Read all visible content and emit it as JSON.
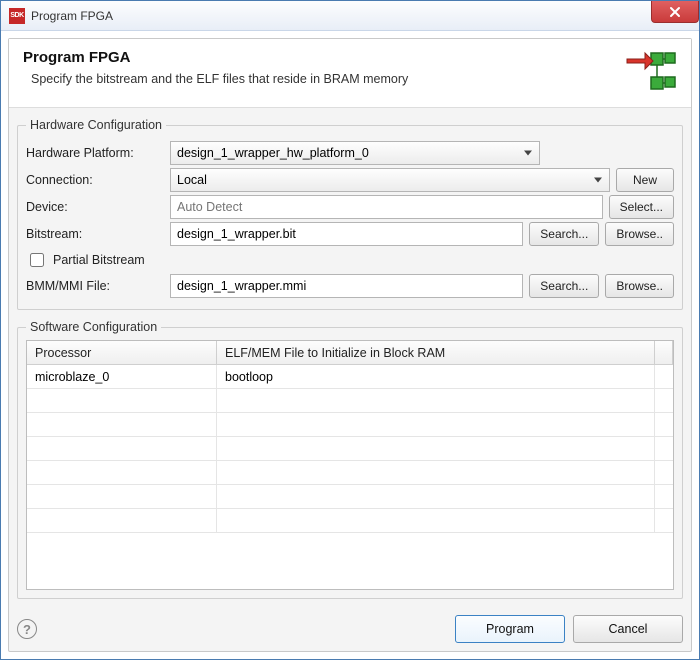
{
  "window": {
    "title": "Program FPGA",
    "app_icon_text": "SDK"
  },
  "banner": {
    "heading": "Program FPGA",
    "description": "Specify the bitstream and the ELF files that reside in BRAM memory"
  },
  "hardware_config": {
    "legend": "Hardware Configuration",
    "labels": {
      "hw_platform": "Hardware Platform:",
      "connection": "Connection:",
      "device": "Device:",
      "bitstream": "Bitstream:",
      "partial_bitstream": "Partial Bitstream",
      "bmm_mmi": "BMM/MMI File:"
    },
    "values": {
      "hw_platform": "design_1_wrapper_hw_platform_0",
      "connection": "Local",
      "device_placeholder": "Auto Detect",
      "bitstream": "design_1_wrapper.bit",
      "bmm_mmi": "design_1_wrapper.mmi"
    },
    "buttons": {
      "new": "New",
      "select": "Select...",
      "search": "Search...",
      "browse": "Browse.."
    }
  },
  "software_config": {
    "legend": "Software Configuration",
    "columns": {
      "processor": "Processor",
      "elf": "ELF/MEM File to Initialize in Block RAM"
    },
    "rows": [
      {
        "processor": "microblaze_0",
        "elf": "bootloop"
      }
    ]
  },
  "footer": {
    "program": "Program",
    "cancel": "Cancel"
  }
}
